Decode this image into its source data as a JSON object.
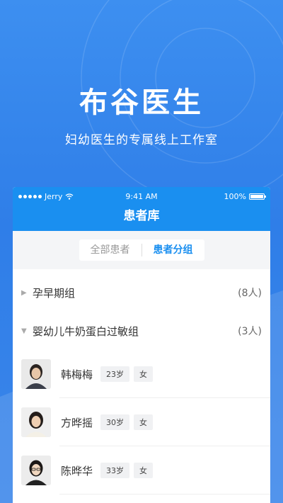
{
  "hero": {
    "title": "布谷医生",
    "subtitle": "妇幼医生的专属线上工作室"
  },
  "status_bar": {
    "carrier": "Jerry",
    "time": "9:41 AM",
    "battery": "100%",
    "battery_level": 1.0
  },
  "nav": {
    "title": "患者库"
  },
  "tabs": [
    {
      "label": "全部患者",
      "active": false
    },
    {
      "label": "患者分组",
      "active": true
    }
  ],
  "groups": [
    {
      "name": "孕早期组",
      "count": "(8人)",
      "expanded": false
    },
    {
      "name": "婴幼儿牛奶蛋白过敏组",
      "count": "(3人)",
      "expanded": true
    }
  ],
  "patients": [
    {
      "name": "韩梅梅",
      "age": "23岁",
      "gender": "女"
    },
    {
      "name": "方晔摇",
      "age": "30岁",
      "gender": "女"
    },
    {
      "name": "陈晔华",
      "age": "33岁",
      "gender": "女"
    }
  ],
  "colors": {
    "brand_blue": "#1a8ff0",
    "background_blue": "#2f7ee8"
  },
  "icons": {
    "signal": "signal-dots-icon",
    "wifi": "wifi-icon",
    "battery": "battery-icon",
    "collapsed": "caret-right-icon",
    "expanded": "caret-down-icon"
  }
}
